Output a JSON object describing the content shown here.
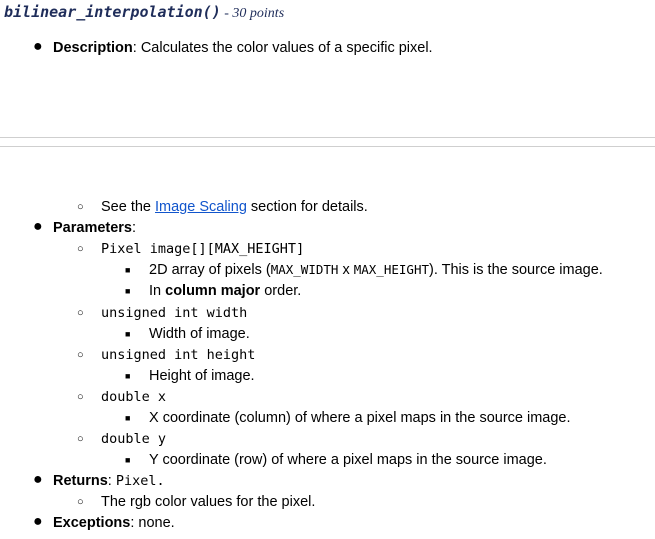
{
  "title": {
    "function_name": "bilinear_interpolation()",
    "points": " - 30 points"
  },
  "description": {
    "label": "Description",
    "text": ": Calculates the color values of a specific pixel."
  },
  "see": {
    "before": "See the ",
    "link": "Image Scaling",
    "after": " section for details."
  },
  "parameters": {
    "label": "Parameters",
    "colon": ":",
    "items": [
      {
        "signature": "Pixel image[][MAX_HEIGHT]",
        "details": [
          {
            "a": "2D array of pixels (",
            "m1": "MAX_WIDTH",
            "x": " x ",
            "m2": "MAX_HEIGHT",
            "b": "). This is the source image."
          },
          {
            "a": "In ",
            "bold": "column major",
            "b": " order."
          }
        ]
      },
      {
        "signature": "unsigned int width",
        "detail": "Width of image."
      },
      {
        "signature": "unsigned int height",
        "detail": "Height of image."
      },
      {
        "signature": "double x",
        "detail": "X coordinate (column) of where a pixel maps in the source image."
      },
      {
        "signature": "double y",
        "detail": "Y coordinate (row) of where a pixel maps in the source image."
      }
    ]
  },
  "returns": {
    "label": "Returns",
    "colon": ": ",
    "type": "Pixel.",
    "detail": "The rgb color values for the pixel."
  },
  "exceptions": {
    "label": "Exceptions",
    "text": ": none."
  },
  "bullets": {
    "disc": "●",
    "circle": "○",
    "square": "■"
  }
}
